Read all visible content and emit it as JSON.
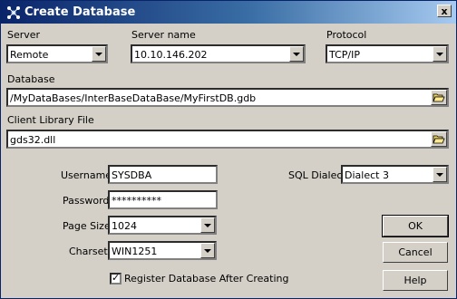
{
  "window": {
    "title": "Create Database",
    "close_glyph": "x",
    "icon": "network-database-icon"
  },
  "server": {
    "label": "Server",
    "value": "Remote"
  },
  "server_name": {
    "label": "Server name",
    "value": "10.10.146.202"
  },
  "protocol": {
    "label": "Protocol",
    "value": "TCP/IP"
  },
  "database": {
    "label": "Database",
    "value": "/MyDataBases/InterBaseDataBase/MyFirstDB.gdb"
  },
  "client_library": {
    "label": "Client Library File",
    "value": "gds32.dll"
  },
  "username": {
    "label": "Username",
    "value": "SYSDBA"
  },
  "password": {
    "label": "Password",
    "value": "**********"
  },
  "page_size": {
    "label": "Page Size",
    "value": "1024"
  },
  "charset": {
    "label": "Charset",
    "value": "WIN1251"
  },
  "sql_dialect": {
    "label": "SQL Dialect",
    "value": "Dialect 3"
  },
  "register_checkbox": {
    "label": "Register Database After Creating",
    "checked": true
  },
  "buttons": {
    "ok": "OK",
    "cancel": "Cancel",
    "help": "Help"
  }
}
